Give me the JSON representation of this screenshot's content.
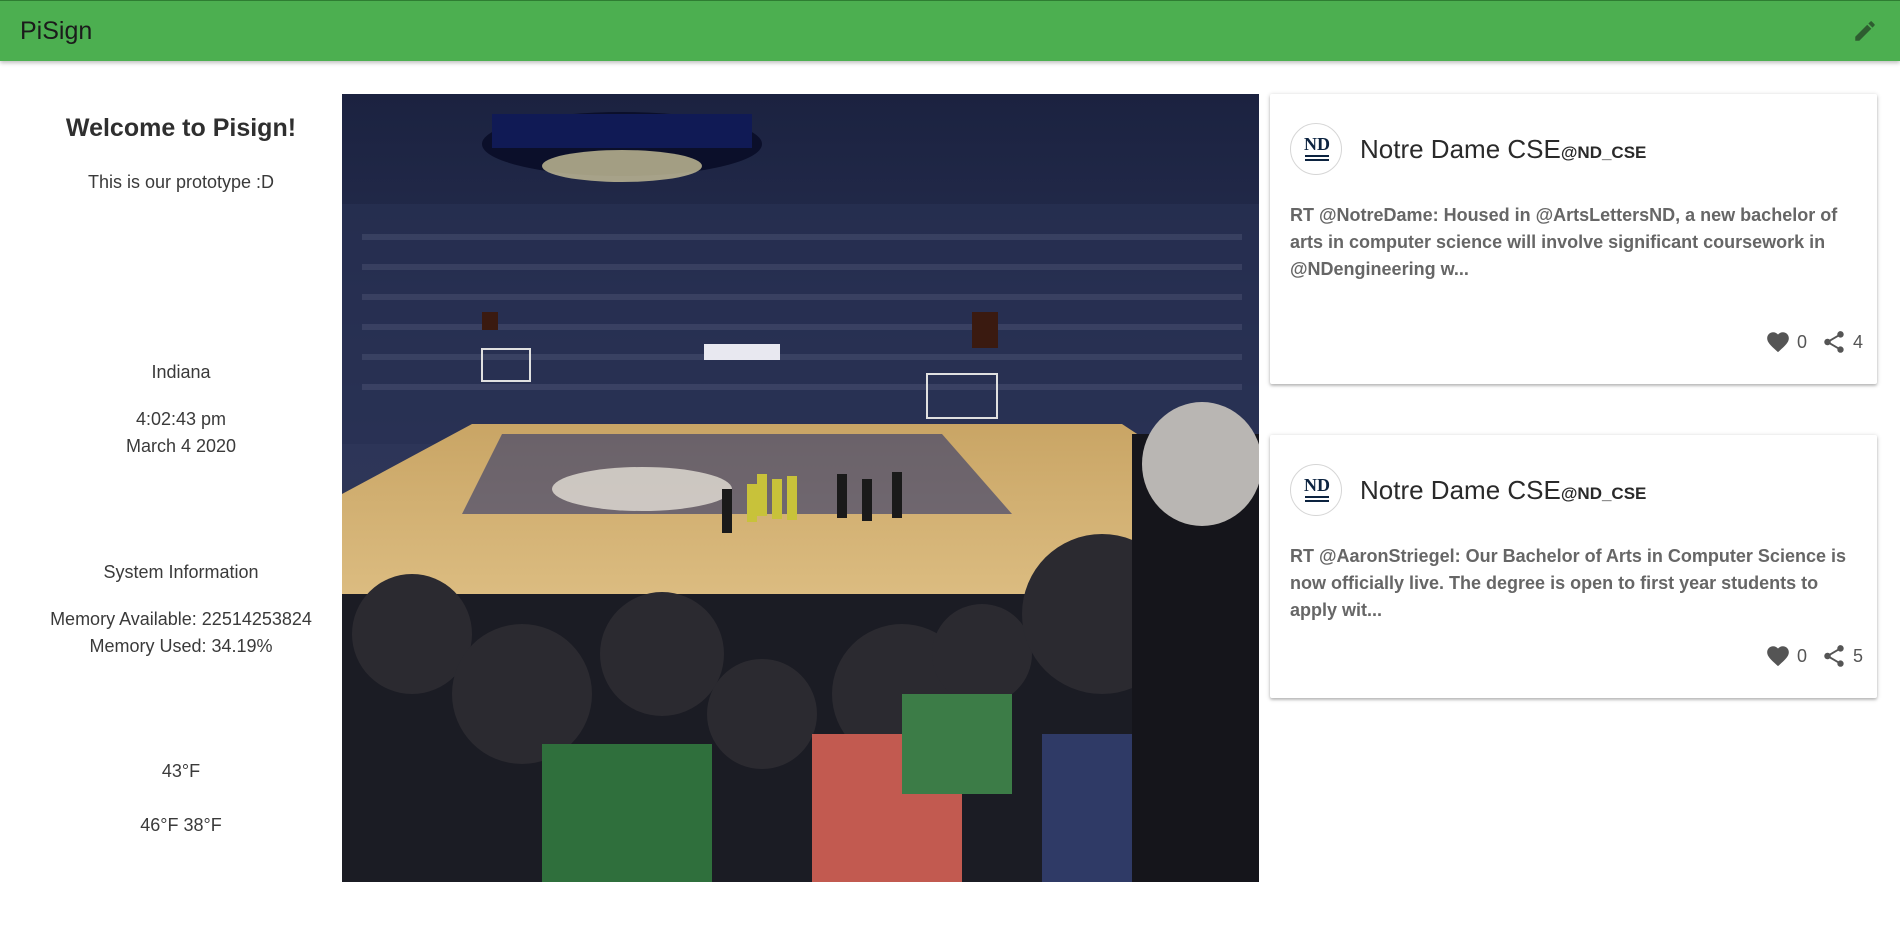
{
  "appbar": {
    "title": "PiSign",
    "edit_icon": "pencil-icon"
  },
  "sidebar": {
    "welcome": "Welcome to Pisign!",
    "subtitle": "This is our prototype :D",
    "location": "Indiana",
    "time": "4:02:43 pm",
    "date": "March 4 2020",
    "system_title": "System Information",
    "memory_available": "Memory Available: 22514253824",
    "memory_used": "Memory Used: 34.19%",
    "temperature": "43°F",
    "high_low": "46°F 38°F"
  },
  "feed": {
    "tweets": [
      {
        "name": "Notre Dame CSE",
        "handle": "@ND_CSE",
        "text": "RT @NotreDame: Housed in @ArtsLettersND, a new bachelor of arts in computer science will involve significant coursework in @NDengineering w...",
        "likes": "0",
        "shares": "4"
      },
      {
        "name": "Notre Dame CSE",
        "handle": "@ND_CSE",
        "text": "RT @AaronStriegel: Our Bachelor of Arts in Computer Science is now officially live. The degree is open to first year students to apply wit...",
        "likes": "0",
        "shares": "5"
      }
    ]
  },
  "colors": {
    "appbar": "#4caf50",
    "icon": "#555555"
  }
}
